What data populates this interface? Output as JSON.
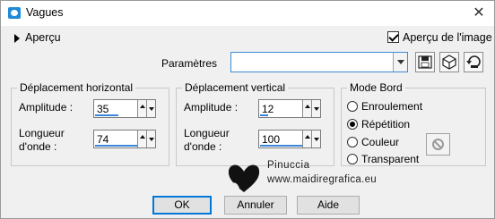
{
  "window": {
    "title": "Vagues",
    "close_glyph": "✕"
  },
  "preview": {
    "label": "Aperçu",
    "checkbox_label": "Aperçu de l'image",
    "checkbox_checked": true
  },
  "params": {
    "label": "Paramètres",
    "value": ""
  },
  "horizontal": {
    "title": "Déplacement horizontal",
    "amplitude_label": "Amplitude :",
    "amplitude_value": "35",
    "wavelength_label_line1": "Longueur",
    "wavelength_label_line2": "d'onde :",
    "wavelength_value": "74"
  },
  "vertical": {
    "title": "Déplacement vertical",
    "amplitude_label": "Amplitude :",
    "amplitude_value": "12",
    "wavelength_label_line1": "Longueur",
    "wavelength_label_line2": "d'onde :",
    "wavelength_value": "100"
  },
  "edge_mode": {
    "title": "Mode Bord",
    "options": [
      "Enroulement",
      "Répétition",
      "Couleur",
      "Transparent"
    ],
    "selected": "Répétition"
  },
  "watermark": {
    "name": "Pinuccia",
    "url": "www.maidiregrafica.eu"
  },
  "buttons": {
    "ok": "OK",
    "cancel": "Annuler",
    "help": "Aide"
  },
  "colors": {
    "accent": "#3a86d8",
    "ok_border": "#0078d7",
    "background": "#f0f0f0"
  },
  "icons": [
    "app-icon",
    "close-icon",
    "expand-arrow-icon",
    "save-icon",
    "cube-icon",
    "reset-icon",
    "no-color-icon",
    "heart-icon"
  ]
}
